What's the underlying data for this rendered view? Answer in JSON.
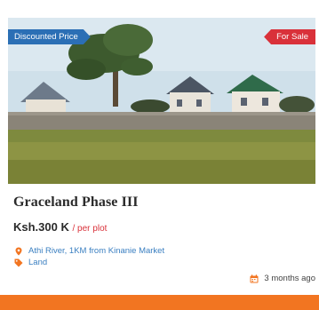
{
  "listing": {
    "badge_left": "Discounted Price",
    "badge_right": "For Sale",
    "title": "Graceland Phase III",
    "price": "Ksh.300 K",
    "price_unit": "/ per plot",
    "location": "Athi River, 1KM from Kinanie Market",
    "category": "Land",
    "posted": "3 months ago"
  },
  "icons": {
    "location": "map-pin-icon",
    "category": "tag-icon",
    "posted": "calendar-icon"
  },
  "colors": {
    "badge_left_bg": "#2b6fb5",
    "badge_right_bg": "#d9313a",
    "accent_bar": "#f27521",
    "link_blue": "#3a7fc1"
  }
}
